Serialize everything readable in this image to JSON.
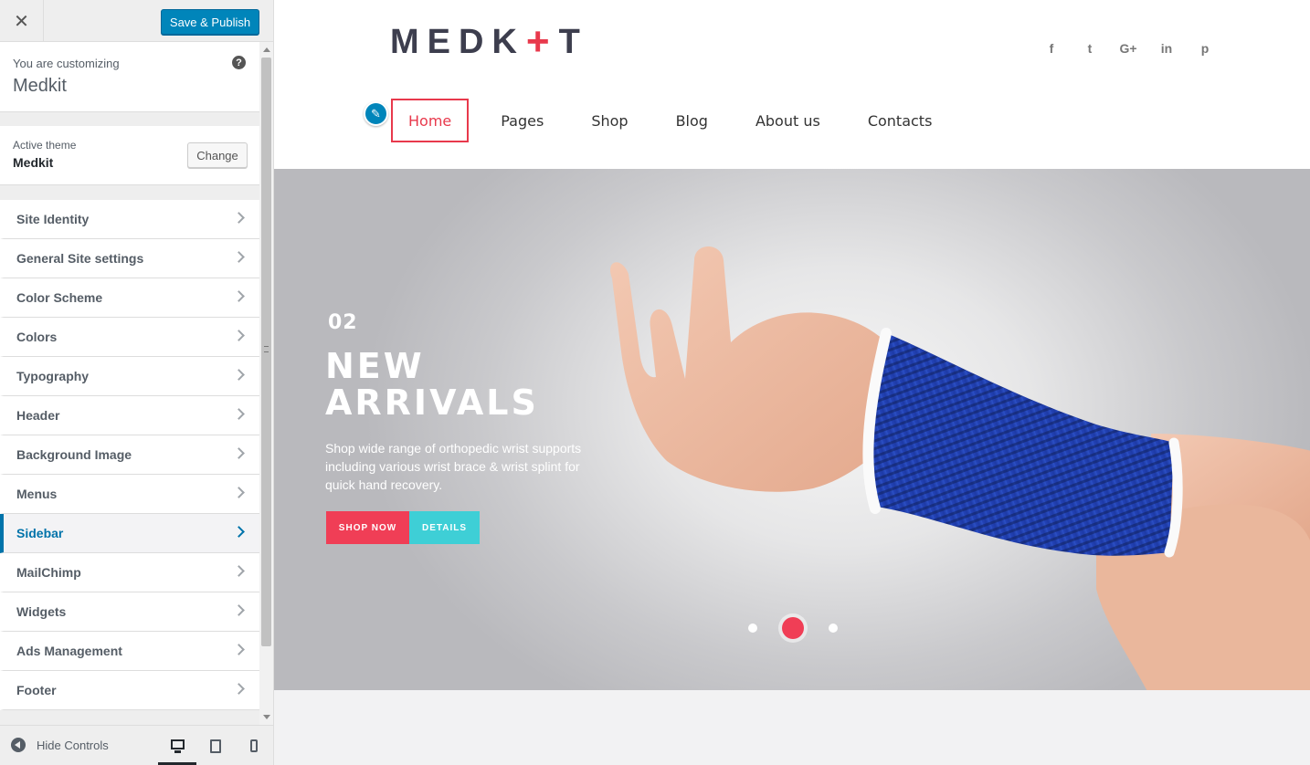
{
  "sidebar": {
    "close_icon": "close-icon",
    "save_label": "Save & Publish",
    "info_pre": "You are customizing",
    "info_title": "Medkit",
    "help_icon": "?",
    "theme_label": "Active theme",
    "theme_name": "Medkit",
    "change_label": "Change",
    "items": [
      {
        "label": "Site Identity"
      },
      {
        "label": "General Site settings"
      },
      {
        "label": "Color Scheme"
      },
      {
        "label": "Colors"
      },
      {
        "label": "Typography"
      },
      {
        "label": "Header"
      },
      {
        "label": "Background Image"
      },
      {
        "label": "Menus"
      },
      {
        "label": "Sidebar"
      },
      {
        "label": "MailChimp"
      },
      {
        "label": "Widgets"
      },
      {
        "label": "Ads Management"
      },
      {
        "label": "Footer"
      }
    ],
    "active_item": "Sidebar",
    "hide_controls": "Hide Controls",
    "devices": [
      "desktop",
      "tablet",
      "mobile"
    ],
    "active_device": "desktop"
  },
  "preview": {
    "logo_left": "MEDK",
    "logo_cross": "+",
    "logo_right": "T",
    "social": {
      "facebook": "f",
      "twitter": "t",
      "googleplus": "G+",
      "linkedin": "in",
      "pinterest": "p"
    },
    "nav": [
      "Home",
      "Pages",
      "Shop",
      "Blog",
      "About us",
      "Contacts"
    ],
    "active_nav": "Home",
    "hero": {
      "number": "02",
      "title_line1": "NEW",
      "title_line2": "ARRIVALS",
      "description": "Shop wide range of orthopedic wrist supports including various wrist brace & wrist splint for quick hand recovery.",
      "shop_label": "SHOP NOW",
      "details_label": "DETAILS",
      "slides_count": 3,
      "active_slide": 2
    }
  },
  "colors": {
    "primary_blue": "#0085ba",
    "brand_red": "#e8394c",
    "shop_button": "#f03e56",
    "details_button": "#3ecfd6",
    "logo_dark": "#3d3e4e"
  }
}
